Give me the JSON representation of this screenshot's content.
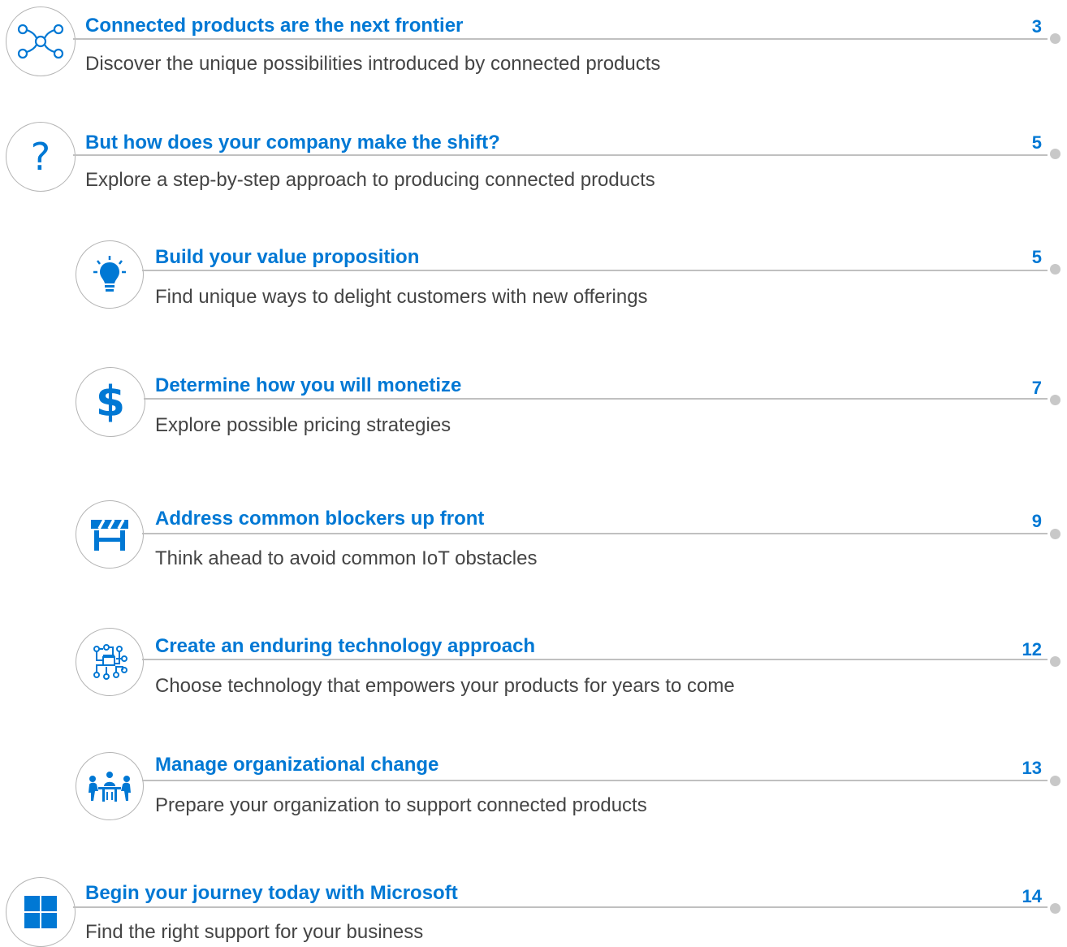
{
  "colors": {
    "accent": "#0078d4",
    "text": "#444444",
    "rule": "#c0c0c0",
    "dot": "#c8c8c8"
  },
  "entries": [
    {
      "icon": "network-nodes-icon",
      "title": "Connected products are the next frontier",
      "description": "Discover the unique possibilities introduced by connected products",
      "page": "3"
    },
    {
      "icon": "question-mark-icon",
      "title": "But how does your company make the shift?",
      "description": "Explore a step-by-step approach to producing connected products",
      "page": "5"
    },
    {
      "icon": "lightbulb-icon",
      "title": "Build your value proposition",
      "description": "Find unique ways to delight customers with new offerings",
      "page": "5"
    },
    {
      "icon": "dollar-icon",
      "title": "Determine how you will monetize",
      "description": "Explore possible pricing strategies",
      "page": "7"
    },
    {
      "icon": "roadblock-icon",
      "title": "Address common blockers up front",
      "description": "Think ahead to avoid common IoT obstacles",
      "page": "9"
    },
    {
      "icon": "circuit-icon",
      "title": "Create an enduring technology approach",
      "description": "Choose technology that empowers your products for years to come",
      "page": "12"
    },
    {
      "icon": "meeting-icon",
      "title": "Manage organizational change",
      "description": "Prepare your organization to support connected products",
      "page": "13"
    },
    {
      "icon": "microsoft-logo-icon",
      "title": "Begin your journey today with Microsoft",
      "description": "Find the right support for your business",
      "page": "14"
    }
  ]
}
